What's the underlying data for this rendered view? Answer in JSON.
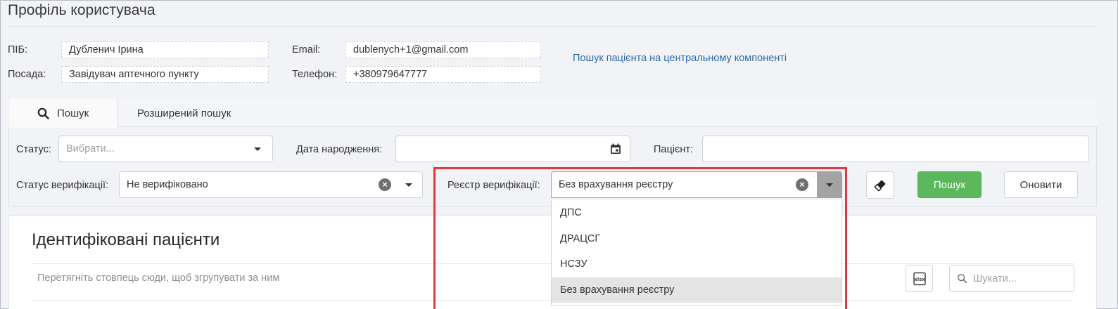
{
  "page": {
    "title": "Профіль користувача"
  },
  "profile": {
    "name_label": "ПІБ:",
    "name_value": "Дубленич Ірина",
    "position_label": "Посада:",
    "position_value": "Завідувач аптечного пункту",
    "email_label": "Email:",
    "email_value": "dublenych+1@gmail.com",
    "phone_label": "Телефон:",
    "phone_value": "+380979647777",
    "central_search_link": "Пошук пацієнта на центральному компоненті"
  },
  "tabs": [
    {
      "label": "Пошук",
      "active": true,
      "icon": "search-icon"
    },
    {
      "label": "Розширений пошук",
      "active": false
    }
  ],
  "filters": {
    "status_label": "Статус:",
    "status_placeholder": "Вибрати...",
    "birthdate_label": "Дата народження:",
    "birthdate_value": "",
    "patient_label": "Пацієнт:",
    "patient_value": "",
    "verification_status_label": "Статус верифікації:",
    "verification_status_value": "Не верифіковано",
    "verification_registry_label": "Реєстр верифікації:",
    "verification_registry_value": "Без врахування реєстру",
    "registry_options": [
      "ДПС",
      "ДРАЦСГ",
      "НСЗУ",
      "Без врахування реєстру"
    ],
    "registry_selected_index": 3
  },
  "buttons": {
    "search": "Пошук",
    "refresh": "Оновити"
  },
  "results": {
    "title": "Ідентифіковані пацієнти",
    "group_hint": "Перетягніть стовпець сюди, щоб згрупувати за ним",
    "search_placeholder": "Шукати..."
  },
  "colors": {
    "accent_green": "#5cb85c",
    "link_blue": "#2c6aa8",
    "highlight_red": "#e0393e"
  }
}
